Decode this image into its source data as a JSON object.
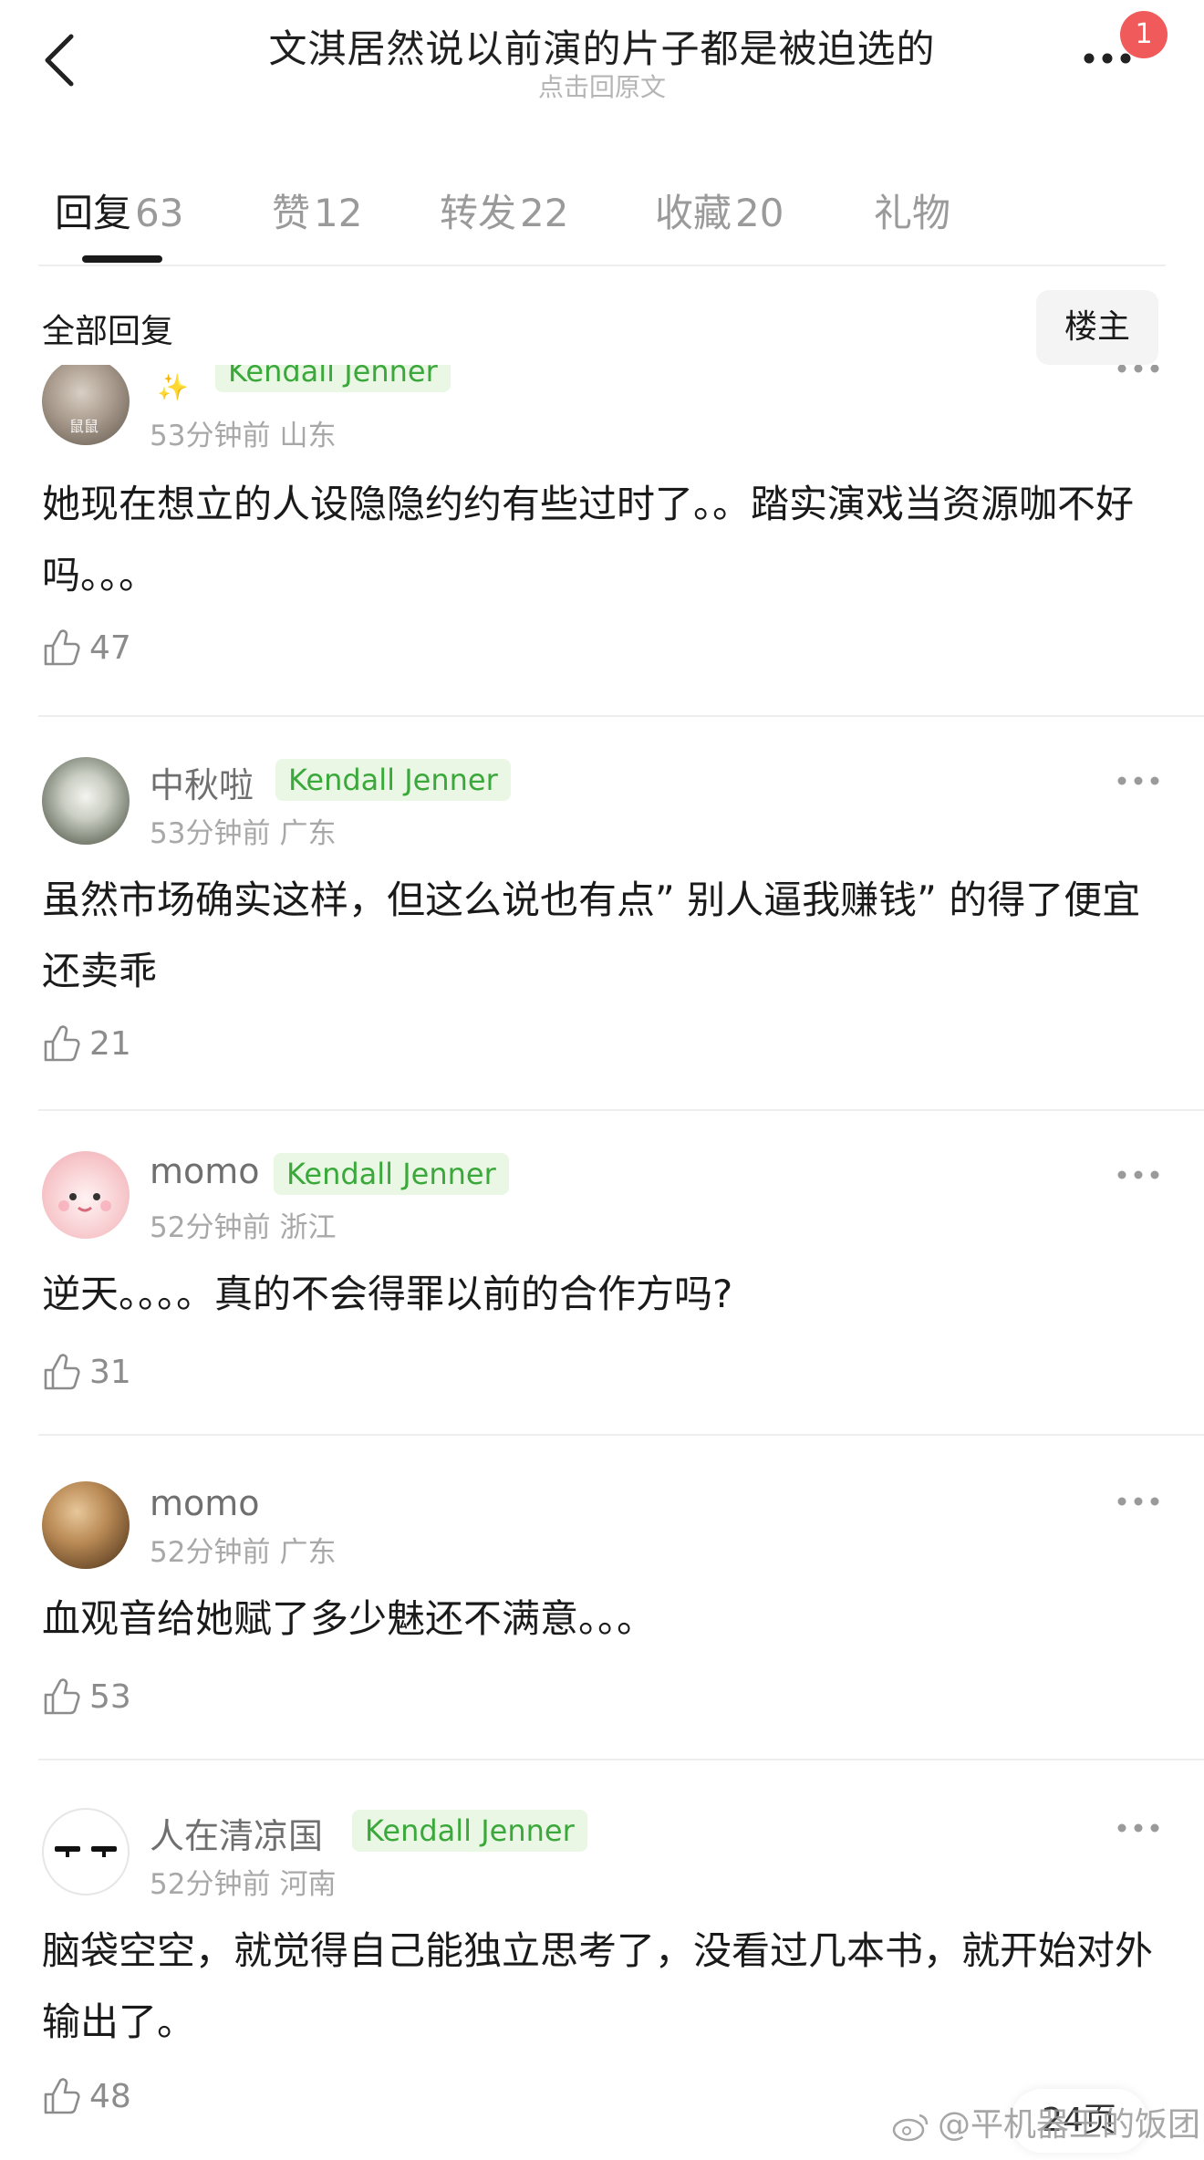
{
  "header": {
    "title": "文淇居然说以前演的片子都是被迫选的",
    "subtitle": "点击回原文",
    "notification_count": "1"
  },
  "tabs": [
    {
      "label": "回复",
      "count": "63",
      "active": true
    },
    {
      "label": "赞",
      "count": "12",
      "active": false
    },
    {
      "label": "转发",
      "count": "22",
      "active": false
    },
    {
      "label": "收藏",
      "count": "20",
      "active": false
    },
    {
      "label": "礼物",
      "count": "",
      "active": false
    }
  ],
  "filter": {
    "all_label": "全部回复",
    "owner_label": "楼主"
  },
  "comments": [
    {
      "username": "",
      "badge": "Kendall Jenner",
      "time": "53分钟前",
      "location": "山东",
      "text": "她现在想立的人设隐隐约约有些过时了。。踏实演戏当资源咖不好吗。。。",
      "likes": "47",
      "avatar_text": "鼠鼠"
    },
    {
      "username": "中秋啦",
      "badge": "Kendall Jenner",
      "time": "53分钟前",
      "location": "广东",
      "text": "虽然市场确实这样，但这么说也有点” 别人逼我赚钱” 的得了便宜还卖乖",
      "likes": "21"
    },
    {
      "username": "momo",
      "badge": "Kendall Jenner",
      "time": "52分钟前",
      "location": "浙江",
      "text": "逆天。。。。真的不会得罪以前的合作方吗?",
      "likes": "31"
    },
    {
      "username": "momo",
      "badge": "",
      "time": "52分钟前",
      "location": "广东",
      "text": "血观音给她赋了多少魅还不满意。。。",
      "likes": "53"
    },
    {
      "username": "人在清凉国",
      "badge": "Kendall Jenner",
      "time": "52分钟前",
      "location": "河南",
      "text": "脑袋空空，就觉得自己能独立思考了，没看过几本书，就开始对外输出了。",
      "likes": "48"
    }
  ],
  "pager": "24页",
  "watermark": "@平机器王的饭团",
  "colors": {
    "badge_bg": "#eaf7e4",
    "badge_text": "#3aa83a",
    "notification": "#f15a5a"
  }
}
